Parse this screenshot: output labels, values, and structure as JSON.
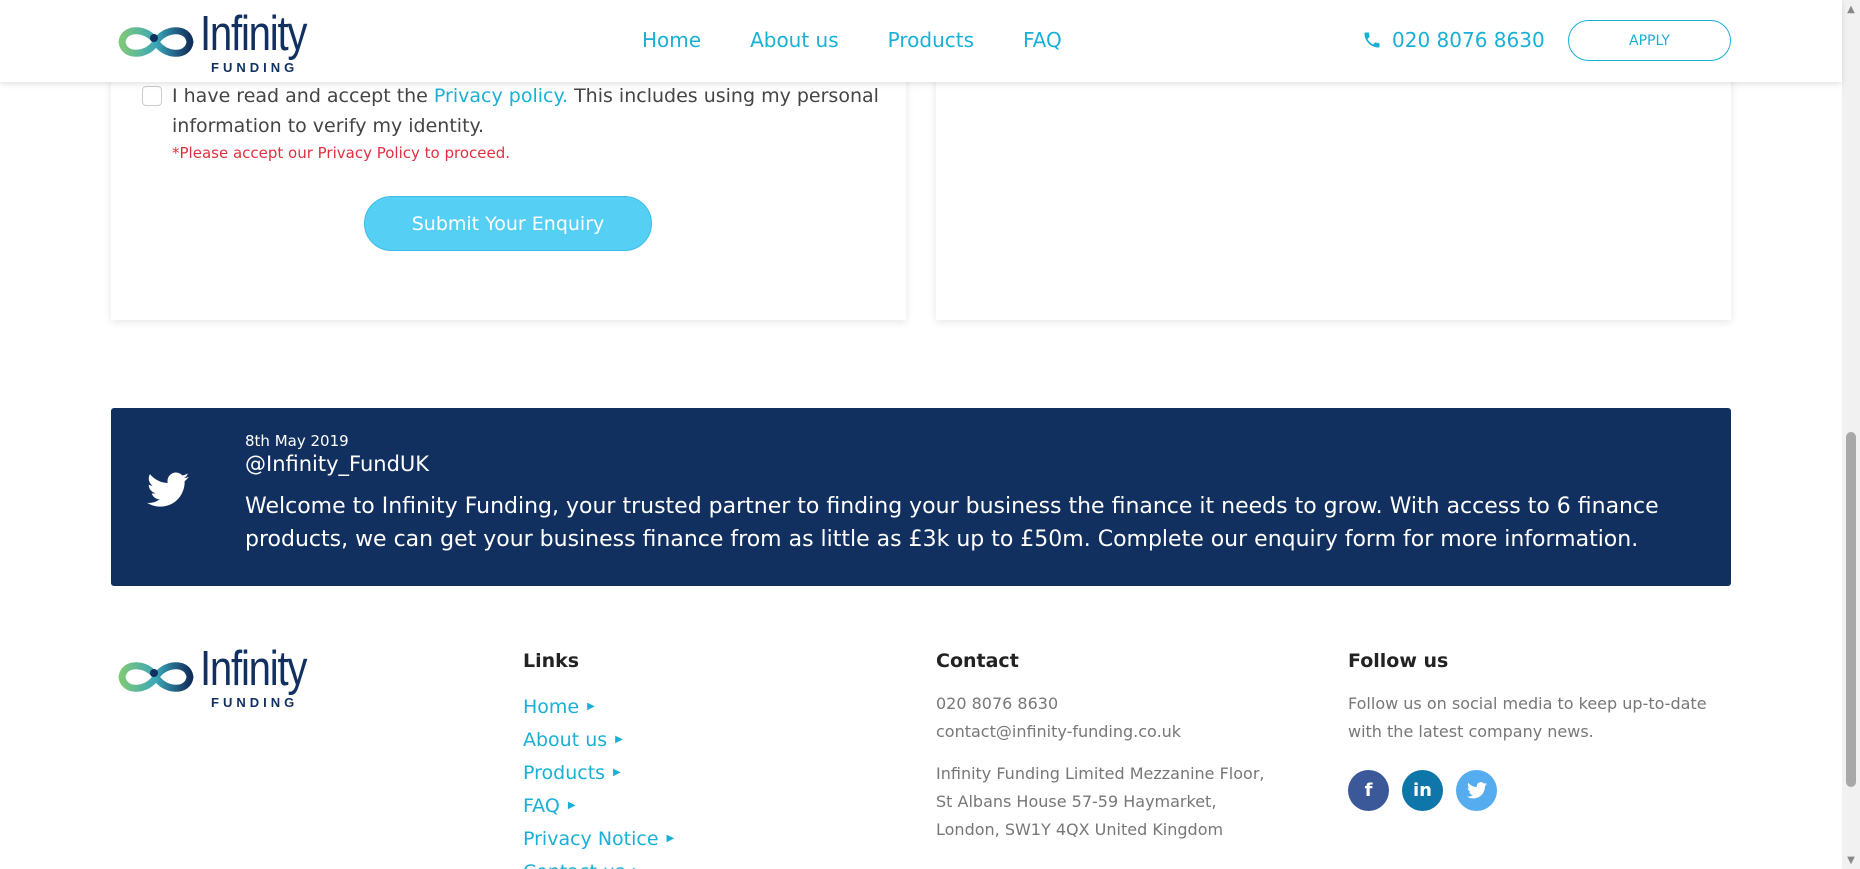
{
  "header": {
    "logo": {
      "word1": "Infinity",
      "word2": "FUNDING"
    },
    "nav": [
      {
        "label": "Home"
      },
      {
        "label": "About us"
      },
      {
        "label": "Products"
      },
      {
        "label": "FAQ"
      }
    ],
    "phone": "020 8076 8630",
    "apply_label": "APPLY"
  },
  "form": {
    "consent_prefix": "I have read and accept the ",
    "consent_link": "Privacy policy.",
    "consent_suffix": " This includes using my personal information to verify my identity.",
    "checkbox_checked": false,
    "error": "*Please accept our Privacy Policy to proceed.",
    "submit_label": "Submit Your Enquiry"
  },
  "tweet": {
    "date": "8th May 2019",
    "handle": "@Infinity_FundUK",
    "text": "Welcome to Infinity Funding, your trusted partner to finding your business the finance it needs to grow. With access to 6 finance products, we can get your business finance from as little as £3k up to £50m. Complete our enquiry form for more information."
  },
  "footer": {
    "logo": {
      "word1": "Infinity",
      "word2": "FUNDING"
    },
    "links_title": "Links",
    "links": [
      {
        "label": "Home"
      },
      {
        "label": "About us"
      },
      {
        "label": "Products"
      },
      {
        "label": "FAQ"
      },
      {
        "label": "Privacy Notice"
      },
      {
        "label": "Contact us"
      }
    ],
    "contact_title": "Contact",
    "contact_phone": "020 8076 8630",
    "contact_email": "contact@infinity-funding.co.uk",
    "contact_address": "Infinity Funding Limited Mezzanine Floor, St Albans House 57-59 Haymarket, London, SW1Y 4QX United Kingdom",
    "follow_title": "Follow us",
    "follow_text": "Follow us on social media to keep up-to-date with the latest company news.",
    "socials": [
      {
        "icon": "facebook-icon",
        "glyph": "f",
        "color": "#3b5998"
      },
      {
        "icon": "linkedin-icon",
        "glyph": "in",
        "color": "#0e76a8"
      },
      {
        "icon": "twitter-icon",
        "color": "#55acee"
      }
    ]
  },
  "colors": {
    "accent": "#1ab0d6",
    "navy": "#12305f",
    "error": "#e0303f",
    "button": "#56cff5"
  }
}
